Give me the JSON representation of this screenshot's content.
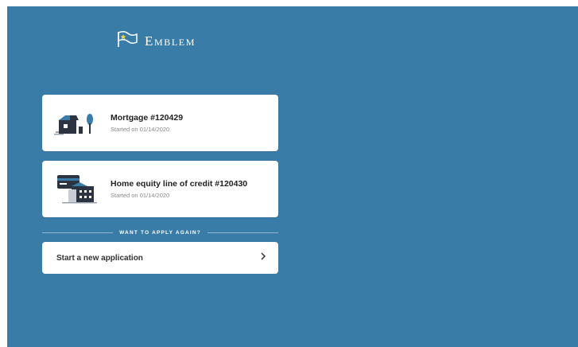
{
  "brand": {
    "name": "Emblem",
    "icon": "flag-icon"
  },
  "applications": [
    {
      "title": "Mortgage #120429",
      "started": "Started on 01/14/2020",
      "icon": "house-tree-illustration"
    },
    {
      "title": "Home equity line of credit #120430",
      "started": "Started on 01/14/2020",
      "icon": "credit-card-building-illustration"
    }
  ],
  "reapply": {
    "heading": "WANT TO APPLY AGAIN?",
    "button_label": "Start a new application",
    "icon": "chevron-right-icon"
  },
  "colors": {
    "background": "#3a7ca8",
    "card": "#ffffff",
    "illustration_dark": "#2b3440",
    "illustration_blue": "#3a7ca8"
  }
}
